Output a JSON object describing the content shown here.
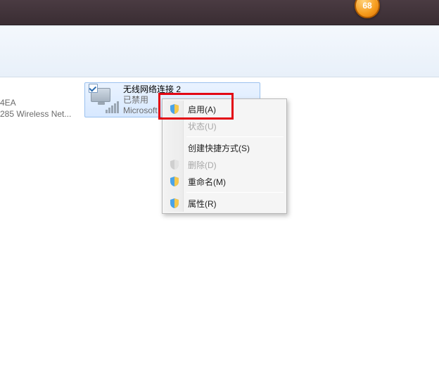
{
  "badge": {
    "count": "68"
  },
  "left_fragment": {
    "line1": "4EA",
    "line2": "285 Wireless Net..."
  },
  "adapter": {
    "name": "无线网络连接 2",
    "status": "已禁用",
    "vendor": "Microsoft"
  },
  "context_menu": {
    "items": [
      {
        "key": "enable",
        "label": "启用(A)",
        "disabled": false,
        "shield": true
      },
      {
        "key": "status",
        "label": "状态(U)",
        "disabled": true,
        "shield": false
      },
      {
        "key": "shortcut",
        "label": "创建快捷方式(S)",
        "disabled": false,
        "shield": false
      },
      {
        "key": "delete",
        "label": "删除(D)",
        "disabled": true,
        "shield": true
      },
      {
        "key": "rename",
        "label": "重命名(M)",
        "disabled": false,
        "shield": true
      },
      {
        "key": "props",
        "label": "属性(R)",
        "disabled": false,
        "shield": true
      }
    ]
  }
}
